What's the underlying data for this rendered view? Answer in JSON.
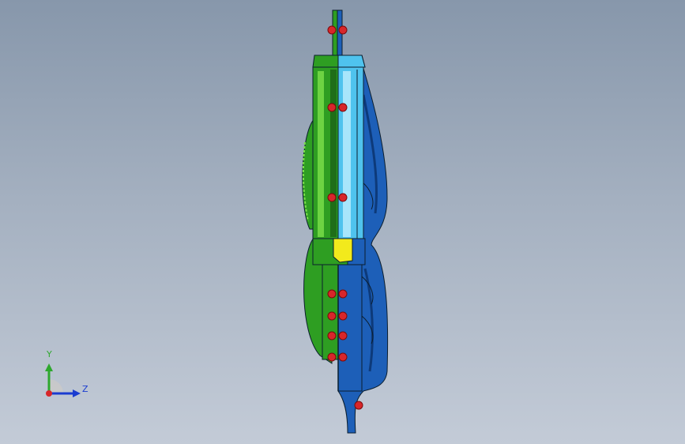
{
  "viewport": {
    "background_top": "#8797ab",
    "background_bottom": "#c3cbd7"
  },
  "model": {
    "part_colors": {
      "left_half": "#2e9e22",
      "left_highlight": "#7de04c",
      "right_body": "#1d5fb8",
      "right_dark": "#0d3a7a",
      "inner_tube": "#4fc3ee",
      "inner_tube_light": "#a8e6fb",
      "bolt": "#d8262a",
      "insert": "#f2ea1c",
      "edge": "#0b1e2e"
    }
  },
  "triad": {
    "y_label": "Y",
    "z_label": "Z",
    "y_color": "#2ea82e",
    "z_color": "#1a3cd0",
    "origin_color": "#d8262a"
  }
}
